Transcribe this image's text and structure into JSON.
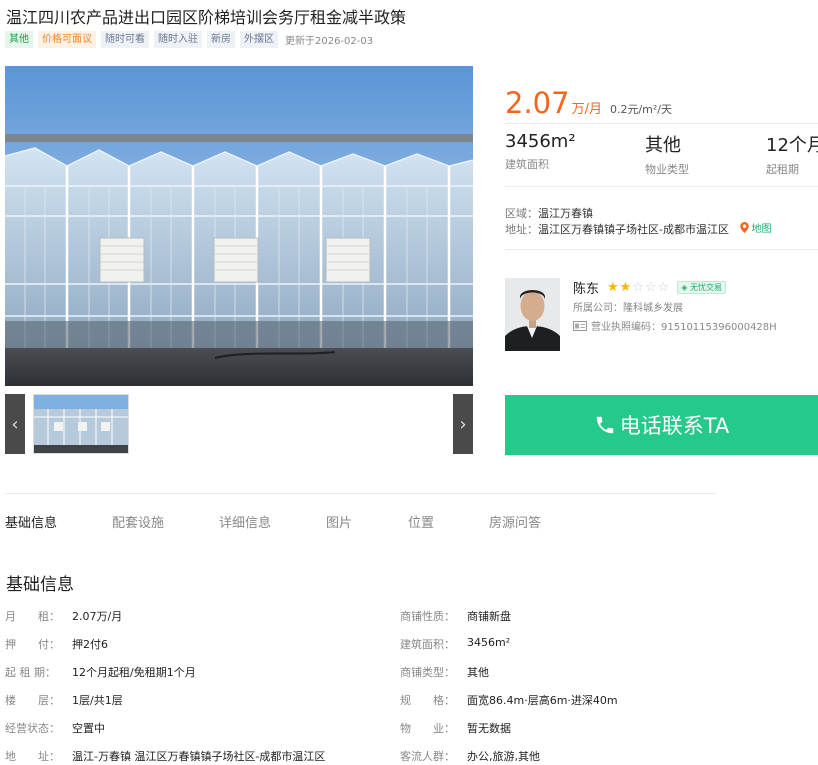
{
  "title": "温江四川农产品进出口园区阶梯培训会务厅租金减半政策",
  "tags": [
    {
      "label": "其他",
      "style": "green"
    },
    {
      "label": "价格可面议",
      "style": "orange"
    },
    {
      "label": "随时可看",
      "style": "gray"
    },
    {
      "label": "随时入驻",
      "style": "gray"
    },
    {
      "label": "新房",
      "style": "gray"
    },
    {
      "label": "外摆区",
      "style": "gray"
    }
  ],
  "updated": "更新于2026-02-03",
  "price": {
    "value": "2.07",
    "unit": "万/月",
    "per_unit": "0.2元/m²/天"
  },
  "stats": [
    {
      "value": "3456m²",
      "label": "建筑面积"
    },
    {
      "value": "其他",
      "label": "物业类型"
    },
    {
      "value": "12个月",
      "label": "起租期"
    }
  ],
  "location": {
    "area_label": "区域：",
    "area": "温江万春镇",
    "address_label": "地址：",
    "address": "温江区万春镇镇子场社区-成都市温江区",
    "map_link": "地图"
  },
  "agent": {
    "name": "陈东",
    "rating": 2,
    "max_rating": 5,
    "badge": "无忧交易",
    "company_label": "所属公司：",
    "company": "隆科城乡发展",
    "license_label": "营业执照编码：",
    "license": "91510115396000428H"
  },
  "call_button": "电话联系TA",
  "tabs": [
    "基础信息",
    "配套设施",
    "详细信息",
    "图片",
    "位置",
    "房源问答"
  ],
  "section_title": "基础信息",
  "info_left": [
    {
      "label": "月　　租：",
      "value": "2.07万/月"
    },
    {
      "label": "押　　付：",
      "value": "押2付6"
    },
    {
      "label": "起 租 期：",
      "value": "12个月起租/免租期1个月"
    },
    {
      "label": "楼　　层：",
      "value": "1层/共1层"
    },
    {
      "label": "经营状态：",
      "value": "空置中"
    },
    {
      "label": "地　　址：",
      "value": "温江-万春镇 温江区万春镇镇子场社区-成都市温江区"
    }
  ],
  "info_right": [
    {
      "label": "商铺性质：",
      "value": "商铺新盘"
    },
    {
      "label": "建筑面积：",
      "value": "3456m²"
    },
    {
      "label": "商铺类型：",
      "value": "其他"
    },
    {
      "label": "规　　格：",
      "value": "面宽86.4m·层高6m·进深40m"
    },
    {
      "label": "物　　业：",
      "value": "暂无数据"
    },
    {
      "label": "客流人群：",
      "value": "办公,旅游,其他"
    }
  ],
  "colors": {
    "accent": "#f2661f",
    "call": "#25c98b",
    "tag_green": "#1f9a4d",
    "tag_orange": "#e9882d"
  },
  "icons": {
    "prev": "chevron-left-icon",
    "next": "chevron-right-icon",
    "map": "map-pin-icon",
    "phone": "phone-icon",
    "license": "id-card-icon"
  }
}
